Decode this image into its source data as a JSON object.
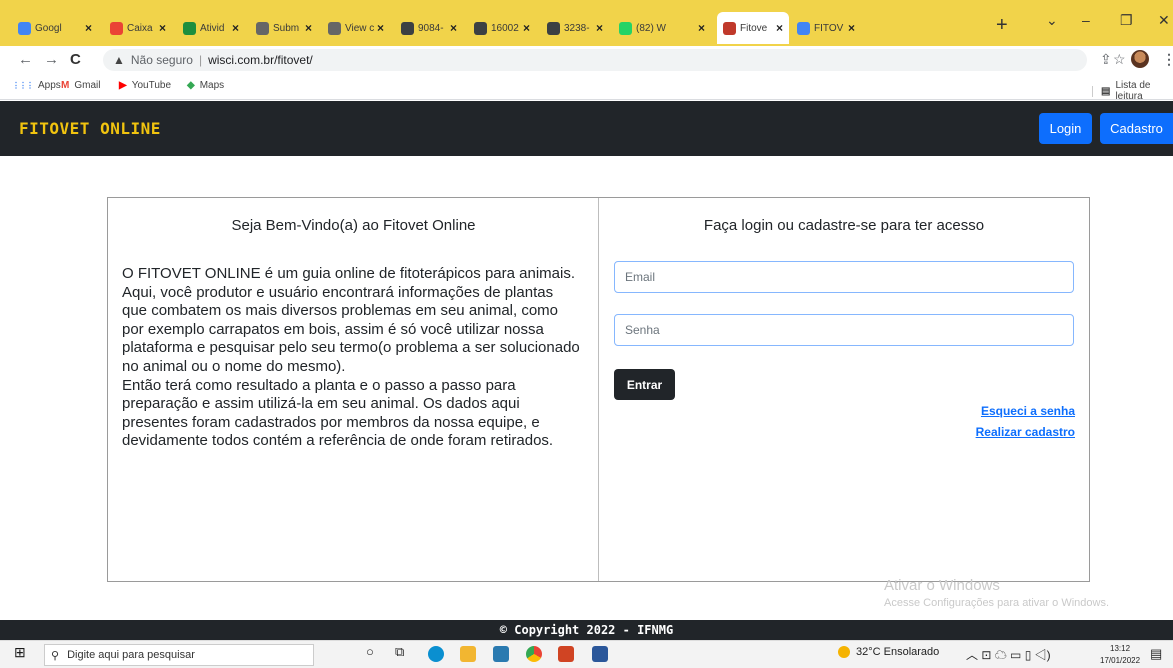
{
  "browser": {
    "tabs": [
      {
        "label": "Googl",
        "color": "#4285f4"
      },
      {
        "label": "Caixa",
        "color": "#ea4335",
        "icon": "M"
      },
      {
        "label": "Ativid",
        "color": "#1e8e3e"
      },
      {
        "label": "Subm",
        "color": "#666666",
        "icon": "PKP"
      },
      {
        "label": "View c",
        "color": "#666666",
        "icon": "PKP"
      },
      {
        "label": "9084-",
        "color": "#3c4043"
      },
      {
        "label": "16002",
        "color": "#3c4043"
      },
      {
        "label": "3238-",
        "color": "#3c4043"
      },
      {
        "label": "(82) W",
        "color": "#25d366"
      },
      {
        "label": "Fitove",
        "color": "#c0392b"
      },
      {
        "label": "FITOV",
        "color": "#4285f4",
        "icon": "G"
      }
    ],
    "close_glyph": "×",
    "newtab_glyph": "+",
    "security_label": "Não seguro",
    "url": "wisci.com.br/fitovet/",
    "bookmarks": [
      {
        "label": "Apps",
        "icon": "⋮⋮⋮",
        "color": "#4285f4"
      },
      {
        "label": "Gmail",
        "icon": "M",
        "color": "#ea4335"
      },
      {
        "label": "YouTube",
        "icon": "▶",
        "color": "#ff0000"
      },
      {
        "label": "Maps",
        "icon": "◆",
        "color": "#34a853"
      }
    ],
    "reading_list": "Lista de leitura"
  },
  "site": {
    "brand": "FITOVET ONLINE",
    "login_button": "Login",
    "signup_button": "Cadastro",
    "accent": "#0d6efd",
    "brand_color": "#f1c40f"
  },
  "welcome": {
    "title": "Seja Bem-Vindo(a) ao Fitovet Online",
    "paragraphs": [
      "O FITOVET ONLINE é um guia online de fitoterápicos para animais.",
      "Aqui, você produtor e usuário encontrará informações de plantas que combatem os mais diversos problemas em seu animal, como por exemplo carrapatos em bois, assim é só você utilizar nossa plataforma e pesquisar pelo seu termo(o problema a ser solucionado no animal ou o nome do mesmo).",
      "Então terá como resultado a planta e o passo a passo para preparação e assim utilizá-la em seu animal. Os dados aqui presentes foram cadastrados por membros da nossa equipe, e devidamente todos contém a referência de onde foram retirados."
    ]
  },
  "login": {
    "title": "Faça login ou cadastre-se para ter acesso",
    "email_placeholder": "Email",
    "password_placeholder": "Senha",
    "submit": "Entrar",
    "forgot": "Esqueci a senha",
    "register": "Realizar cadastro"
  },
  "watermark": {
    "line1": "Ativar o Windows",
    "line2": "Acesse Configurações para ativar o Windows."
  },
  "footer": {
    "text": "© Copyright 2022 - IFNMG"
  },
  "taskbar": {
    "search_placeholder": "Digite aqui para pesquisar",
    "weather": "32°C  Ensolarado",
    "time": "13:12",
    "date": "17/01/2022"
  }
}
